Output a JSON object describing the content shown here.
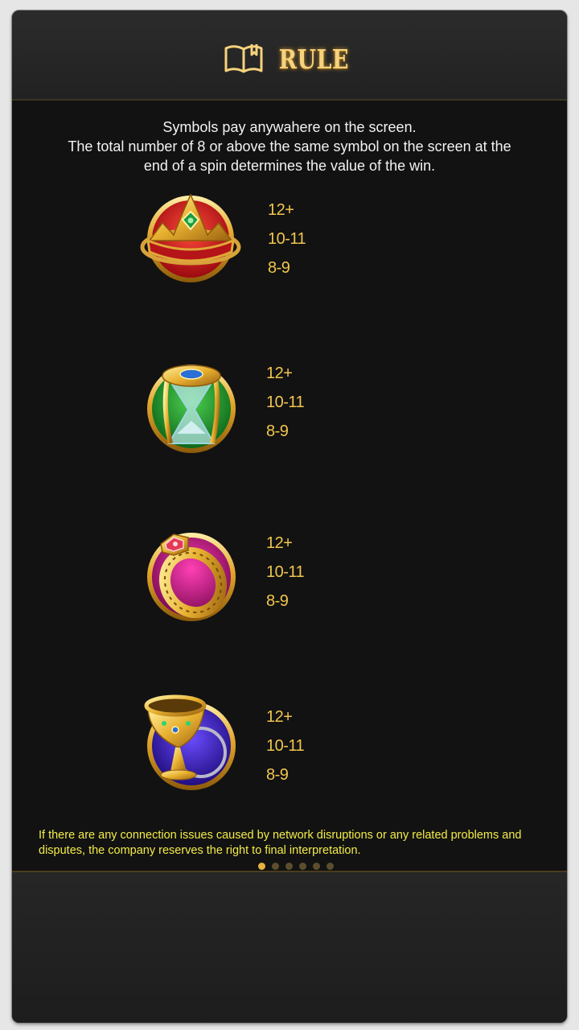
{
  "header": {
    "title": "RULE",
    "icon": "open-book-icon"
  },
  "intro": {
    "line1": "Symbols pay anywahere on the screen.",
    "line2": "The total number of  8 or above the same symbol on the screen at the",
    "line3": "end of a spin determines the value of the win."
  },
  "symbols": [
    {
      "icon": "crown-icon",
      "pays": [
        "12+",
        "10-11",
        "8-9"
      ]
    },
    {
      "icon": "hourglass-icon",
      "pays": [
        "12+",
        "10-11",
        "8-9"
      ]
    },
    {
      "icon": "ring-icon",
      "pays": [
        "12+",
        "10-11",
        "8-9"
      ]
    },
    {
      "icon": "chalice-icon",
      "pays": [
        "12+",
        "10-11",
        "8-9"
      ]
    }
  ],
  "disclaimer": "If there are any connection issues caused by network disruptions or any related problems and disputes, the company reserves the right to final interpretation.",
  "pagination": {
    "total_pages": 6,
    "current_page": 1
  },
  "colors": {
    "title": "#f6d37c",
    "pay_text": "#f2c64d",
    "disclaimer_text": "#f4ec48",
    "crown_bg": "#d8171d",
    "hourglass_bg": "#1f9a2f",
    "ring_bg": "#c7168a",
    "chalice_bg": "#3b24b8"
  }
}
